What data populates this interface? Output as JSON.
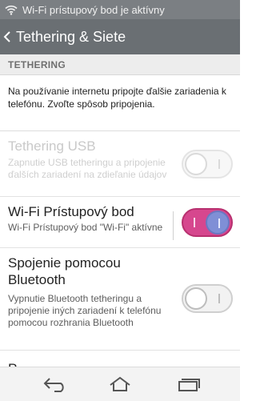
{
  "status_bar": {
    "text": "Wi-Fi prístupový bod je aktívny",
    "icon": "wifi-icon"
  },
  "action_bar": {
    "title": "Tethering & Siete",
    "back_icon": "chevron-left-icon"
  },
  "section": {
    "header": "TETHERING"
  },
  "info": {
    "text": "Na používanie internetu pripojte ďalšie zariadenia k telefónu. Zvoľte spôsob pripojenia."
  },
  "rows": [
    {
      "title": "Tethering USB",
      "subtitle": "Zapnutie USB tetheringu a pripojenie ďalších zariadení na zdieľanie údajov",
      "enabled": false,
      "checked": false
    },
    {
      "title": "Wi-Fi Prístupový bod",
      "subtitle": "Wi-Fi Prístupový bod \"Wi-Fi\" aktívne",
      "enabled": true,
      "checked": true
    },
    {
      "title": "Spojenie pomocou Bluetooth",
      "subtitle": "Vypnutie Bluetooth tetheringu a pripojenie iných zariadení k telefónu pomocou rozhrania Bluetooth",
      "enabled": true,
      "checked": false
    },
    {
      "title": "P..."
    }
  ],
  "navigation": {
    "back_icon": "back-arrow-icon",
    "home_icon": "home-icon",
    "recents_icon": "recents-icon"
  },
  "colors": {
    "accent_on": "#d6478e",
    "knob_on": "#7f8fd6",
    "status_bar": "#7b7f83",
    "action_bar": "#6a6f73"
  }
}
